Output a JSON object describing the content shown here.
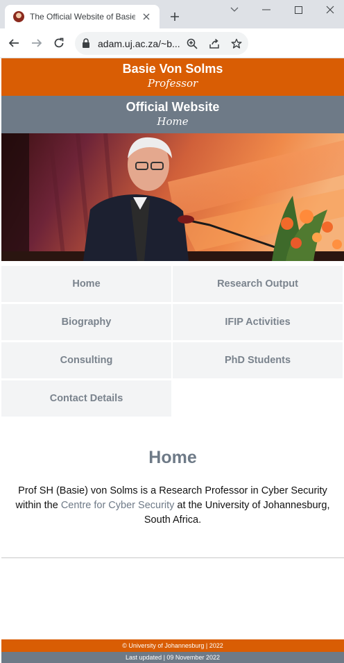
{
  "browser": {
    "tab_title": "The Official Website of Basie",
    "url": "adam.uj.ac.za/~b..."
  },
  "header": {
    "name": "Basie Von Solms",
    "subtitle": "Professor"
  },
  "band": {
    "title": "Official Website",
    "subtitle": "Home"
  },
  "nav": {
    "items": [
      {
        "label": "Home"
      },
      {
        "label": "Research Output"
      },
      {
        "label": "Biography"
      },
      {
        "label": "IFIP Activities"
      },
      {
        "label": "Consulting"
      },
      {
        "label": "PhD Students"
      },
      {
        "label": "Contact Details"
      }
    ]
  },
  "main": {
    "title": "Home",
    "intro_before": "Prof SH (Basie) von Solms is a Research Professor in Cyber Security within the ",
    "intro_link": "Centre for Cyber Security",
    "intro_after": " at the University of Johannesburg, South Africa."
  },
  "footer": {
    "copyright": "© University of Johannesburg | 2022",
    "updated": "Last updated | 09 November 2022"
  },
  "colors": {
    "brand_orange": "#d95d04",
    "brand_slate": "#6e7a87",
    "nav_bg": "#f3f4f5"
  }
}
